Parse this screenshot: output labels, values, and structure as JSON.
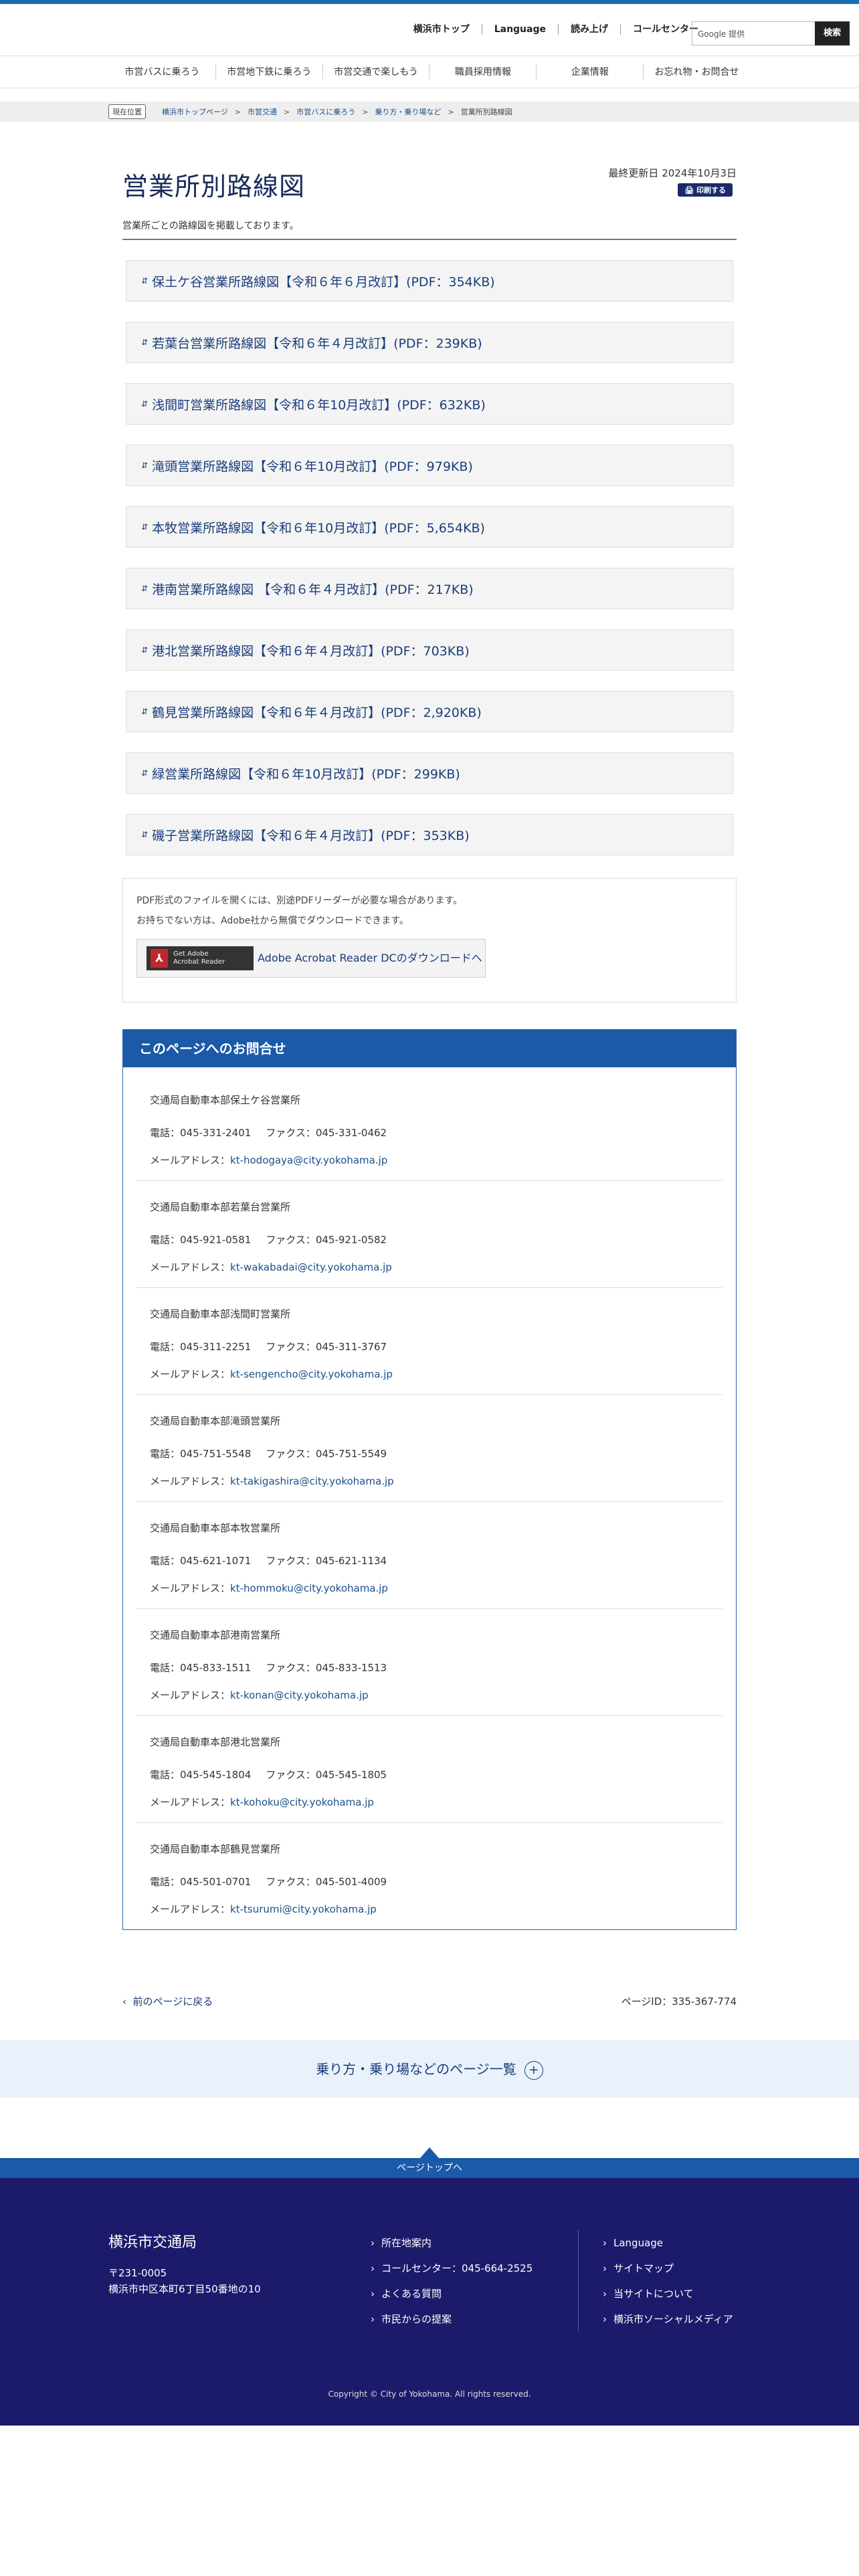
{
  "header": {
    "links": [
      "横浜市トップ",
      "Language",
      "読み上げ",
      "コールセンター"
    ],
    "search_placeholder": "Google 提供",
    "search_button": "検索"
  },
  "gnav": [
    "市営バスに乗ろう",
    "市営地下鉄に乗ろう",
    "市営交通で楽しもう",
    "職員採用情報",
    "企業情報",
    "お忘れ物・お問合せ"
  ],
  "breadcrumb": {
    "label": "現在位置",
    "items": [
      "横浜市トップページ",
      "市営交通",
      "市営バスに乗ろう",
      "乗り方・乗り場など"
    ],
    "current": "営業所別路線図"
  },
  "page": {
    "title": "営業所別路線図",
    "updated": "最終更新日 2024年10月3日",
    "print": "印刷する",
    "lead": "営業所ごとの路線図を掲載しております。"
  },
  "routes": [
    "保土ケ谷営業所路線図【令和６年６月改訂】(PDF：354KB)",
    "若葉台営業所路線図【令和６年４月改訂】(PDF：239KB)",
    "浅間町営業所路線図【令和６年10月改訂】(PDF：632KB)",
    "滝頭営業所路線図【令和６年10月改訂】(PDF：979KB)",
    "本牧営業所路線図【令和６年10月改訂】(PDF：5,654KB)",
    "港南営業所路線図 【令和６年４月改訂】(PDF：217KB)",
    "港北営業所路線図【令和６年４月改訂】(PDF：703KB)",
    "鶴見営業所路線図【令和６年４月改訂】(PDF：2,920KB)",
    "緑営業所路線図【令和６年10月改訂】(PDF：299KB)",
    "磯子営業所路線図【令和６年４月改訂】(PDF：353KB)"
  ],
  "adobe": {
    "line1": "PDF形式のファイルを開くには、別途PDFリーダーが必要な場合があります。",
    "line2": "お持ちでない方は、Adobe社から無償でダウンロードできます。",
    "badge_line1": "Get Adobe",
    "badge_line2": "Acrobat Reader",
    "link": "Adobe Acrobat Reader DCのダウンロードへ"
  },
  "inquiry": {
    "title": "このページへのお問合せ",
    "phone_label": "電話：",
    "fax_label": "ファクス：",
    "mail_label": "メールアドレス：",
    "offices": [
      {
        "name": "交通局自動車本部保土ケ谷営業所",
        "phone": "045-331-2401",
        "fax": "045-331-0462",
        "email": "kt-hodogaya@city.yokohama.jp"
      },
      {
        "name": "交通局自動車本部若葉台営業所",
        "phone": "045-921-0581",
        "fax": "045-921-0582",
        "email": "kt-wakabadai@city.yokohama.jp"
      },
      {
        "name": "交通局自動車本部浅間町営業所",
        "phone": "045-311-2251",
        "fax": "045-311-3767",
        "email": "kt-sengencho@city.yokohama.jp"
      },
      {
        "name": "交通局自動車本部滝頭営業所",
        "phone": "045-751-5548",
        "fax": "045-751-5549",
        "email": "kt-takigashira@city.yokohama.jp"
      },
      {
        "name": "交通局自動車本部本牧営業所",
        "phone": "045-621-1071",
        "fax": "045-621-1134",
        "email": "kt-hommoku@city.yokohama.jp"
      },
      {
        "name": "交通局自動車本部港南営業所",
        "phone": "045-833-1511",
        "fax": "045-833-1513",
        "email": "kt-konan@city.yokohama.jp"
      },
      {
        "name": "交通局自動車本部港北営業所",
        "phone": "045-545-1804",
        "fax": "045-545-1805",
        "email": "kt-kohoku@city.yokohama.jp"
      },
      {
        "name": "交通局自動車本部鶴見営業所",
        "phone": "045-501-0701",
        "fax": "045-501-4009",
        "email": "kt-tsurumi@city.yokohama.jp"
      }
    ]
  },
  "bottom": {
    "back": "前のページに戻る",
    "page_id": "ページID：335-367-774",
    "page_list": "乗り方・乗り場などのページ一覧",
    "to_top": "ページトップへ"
  },
  "footer": {
    "name": "横浜市交通局",
    "postal": "〒231-0005",
    "address": "横浜市中区本町6丁目50番地の10",
    "col1": [
      "所在地案内",
      "コールセンター：045-664-2525",
      "よくある質問",
      "市民からの提案"
    ],
    "col2": [
      "Language",
      "サイトマップ",
      "当サイトについて",
      "横浜市ソーシャルメディア"
    ],
    "copyright": "Copyright © City of Yokohama. All rights reserved."
  },
  "colors": {
    "accent": "#1a5aa8",
    "footer_bg": "#1c1a6b",
    "link": "#1a3d7a"
  }
}
